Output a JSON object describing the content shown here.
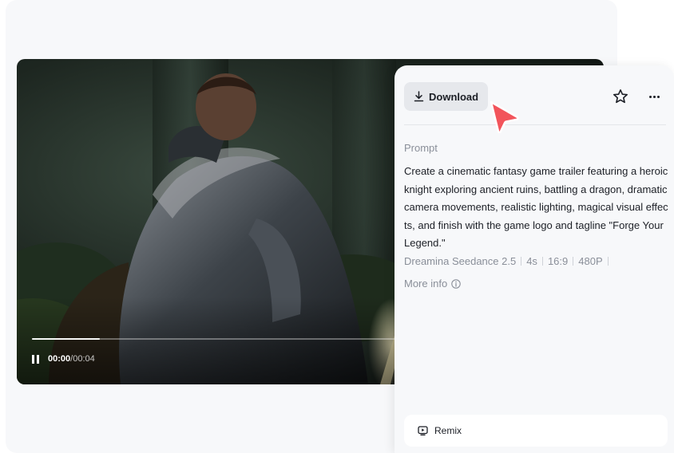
{
  "video": {
    "current_time": "00:00",
    "separator": "/",
    "duration": "00:04",
    "progress": 0.18,
    "pause_icon": "pause-icon"
  },
  "panel": {
    "download_label": "Download",
    "download_icon": "download-icon",
    "star_icon": "star-icon",
    "more_icon": "more-horizontal-icon",
    "prompt_label": "Prompt",
    "prompt_text": "Create a cinematic fantasy game trailer featuring a heroic knight exploring ancient ruins, battling a dragon, dramatic camera movements, realistic lighting, magical visual effects, and finish with the game logo and tagline \"Forge Your Legend.\"",
    "meta": [
      "Dreamina Seedance 2.5",
      "4s",
      "16:9",
      "480P"
    ],
    "more_info_label": "More info",
    "info_icon": "info-icon",
    "remix_label": "Remix",
    "remix_icon": "remix-icon"
  },
  "cursor": {
    "icon": "pointer-cursor-icon",
    "color": "#f2545b"
  },
  "colors": {
    "panel_bg": "#f7f8fa",
    "download_bg": "#e6e8ec",
    "text_primary": "#1c1f26",
    "text_secondary": "#8a8f99"
  }
}
